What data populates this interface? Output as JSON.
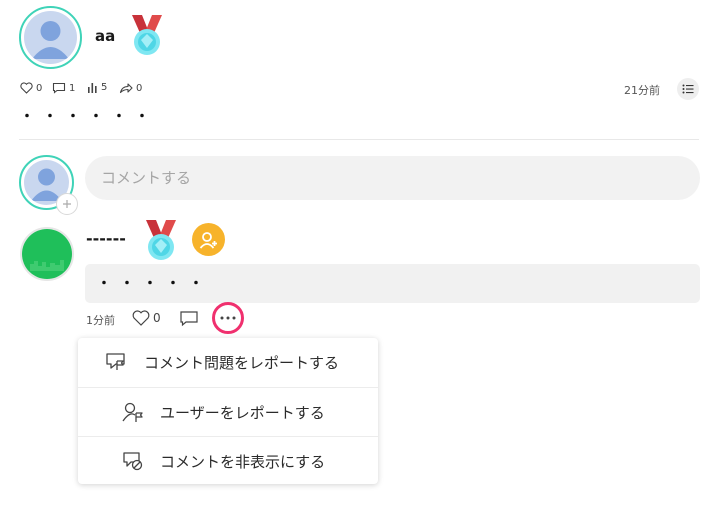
{
  "post": {
    "author": "aa",
    "likes": "0",
    "comments": "1",
    "views": "5",
    "shares": "0",
    "time": "21分前",
    "body": "・・・・・・"
  },
  "comment_box": {
    "placeholder": "コメントする"
  },
  "comment": {
    "author": "------",
    "body": "・・・・・",
    "time": "1分前",
    "likes": "0"
  },
  "menu": {
    "items": [
      {
        "label": "コメント問題をレポートする",
        "icon": "report-comment-icon"
      },
      {
        "label": "ユーザーをレポートする",
        "icon": "report-user-icon"
      },
      {
        "label": "コメントを非表示にする",
        "icon": "hide-comment-icon"
      }
    ]
  },
  "colors": {
    "accent_ring": "#3fd3b8",
    "highlight_ring": "#f0306e",
    "follow_badge": "#f7b32b",
    "commenter_avatar": "#1fbf5a"
  }
}
